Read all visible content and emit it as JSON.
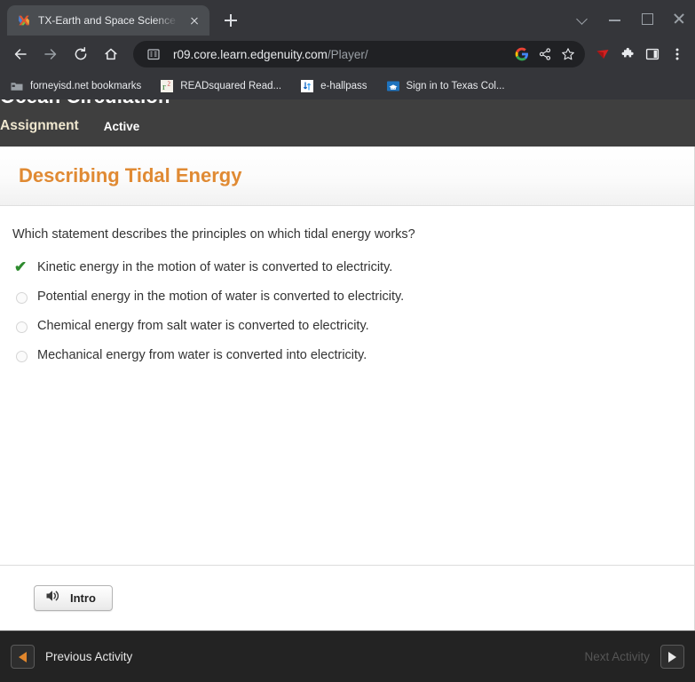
{
  "browser": {
    "tab": {
      "title": "TX-Earth and Space Science B - I",
      "favicon": "edgenuity-x-logo-icon",
      "close": "close-icon"
    },
    "new_tab_label": "new-tab-icon",
    "window_controls": {
      "tab_search": "chevron-down-icon",
      "minimize": "minimize-icon",
      "maximize": "maximize-icon",
      "close": "close-icon"
    },
    "nav": {
      "back": "back-arrow-icon",
      "forward": "forward-arrow-icon",
      "reload": "reload-icon",
      "home": "home-icon"
    },
    "omnibox": {
      "site_icon": "site-info-icon",
      "domain": "r09.core.learn.edgenuity.com",
      "path": "/Player/",
      "google_lens": "google-icon",
      "share": "share-icon",
      "bookmark": "star-icon"
    },
    "extensions": [
      {
        "name": "red-diamond-extension-icon"
      },
      {
        "name": "puzzle-extensions-icon"
      },
      {
        "name": "side-panel-icon"
      },
      {
        "name": "three-dot-menu-icon"
      }
    ],
    "bookmarks": [
      {
        "label": "forneyisd.net bookmarks",
        "icon": "folder-icon"
      },
      {
        "label": "READsquared Read...",
        "icon": "readsquared-icon"
      },
      {
        "label": "e-hallpass",
        "icon": "e-hallpass-icon"
      },
      {
        "label": "Sign in to Texas Col...",
        "icon": "texas-colleges-icon"
      }
    ]
  },
  "player": {
    "course_title": "Ocean Circulation",
    "tabs": {
      "assignment": "Assignment",
      "active": "Active"
    },
    "lesson": {
      "title": "Describing Tidal Energy",
      "question": "Which statement describes the principles on which tidal energy works?",
      "options": [
        {
          "text": "Kinetic energy in the motion of water is converted to electricity.",
          "state": "correct",
          "marker": "green-check-icon"
        },
        {
          "text": "Potential energy in the motion of water is converted to electricity.",
          "state": "unselected",
          "marker": "radio-unselected-icon"
        },
        {
          "text": "Chemical energy from salt water is converted to electricity.",
          "state": "unselected",
          "marker": "radio-unselected-icon"
        },
        {
          "text": "Mechanical energy from water is converted into electricity.",
          "state": "unselected",
          "marker": "radio-unselected-icon"
        }
      ],
      "check_glyph": "✔"
    },
    "audio_button": {
      "label": "Intro",
      "icon": "speaker-icon"
    },
    "activity_bar": {
      "previous_label": "Previous Activity",
      "previous_icon": "triangle-left-icon",
      "next_label": "Next Activity",
      "next_icon": "triangle-right-icon",
      "next_disabled": true
    }
  },
  "colors": {
    "accent_orange": "#e08a33",
    "player_dark": "#3f3f3f",
    "activity_bar_dark": "#232323",
    "chrome_dark": "#35363a",
    "omnibox_dark": "#202124",
    "check_green": "#2e8b2e",
    "assignment_cream": "#efe7cf"
  }
}
